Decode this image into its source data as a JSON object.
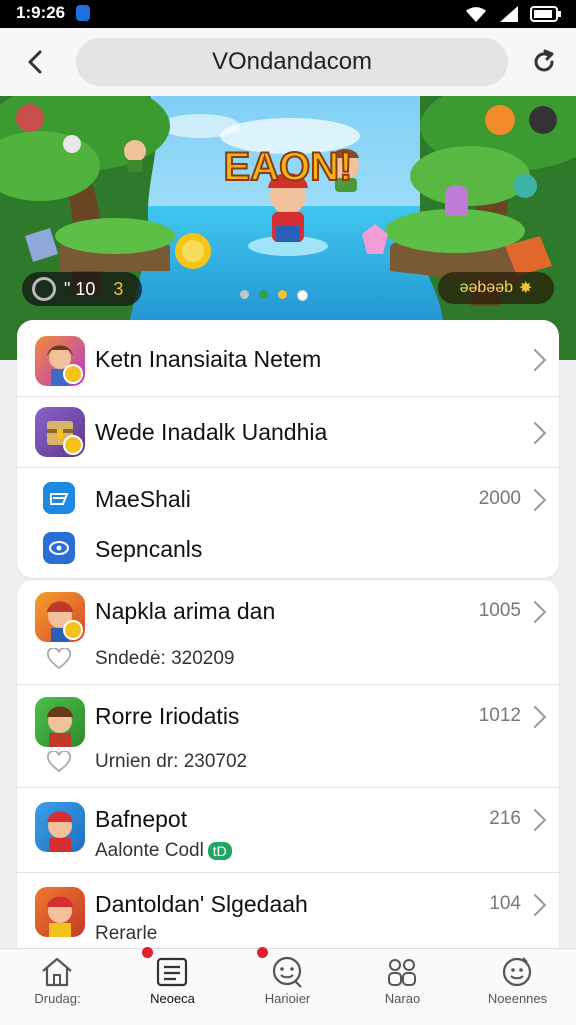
{
  "status_bar": {
    "time": "1:9:26"
  },
  "browser": {
    "url": "VOndandacom"
  },
  "banner": {
    "title": "EAON!",
    "left_pill_text": "\" 10",
    "left_pill_num": "3",
    "right_pill_text": "əəbəəb"
  },
  "menu": [
    {
      "label": "Ketn Inansiaita Netem"
    },
    {
      "label": "Wede Inadalk Uandhia"
    },
    {
      "label": "MaeShali",
      "count": "2000"
    },
    {
      "label": "Sepncanls"
    }
  ],
  "games": [
    {
      "title": "Napkla arima dan",
      "count": "1005",
      "sub": "Sndedė: 320209"
    },
    {
      "title": "Rorre Iriodatis",
      "count": "1012",
      "sub": "Urnien dr: 230702"
    },
    {
      "title": "Bafnepot",
      "count": "216",
      "sub": "Aalonte Codl",
      "badge": "tD"
    },
    {
      "title": "Dantoldan' Slgedaah",
      "count": "104",
      "sub": "Rerarle"
    }
  ],
  "tabs": [
    {
      "label": "Drudag:",
      "icon": "home-icon"
    },
    {
      "label": "Neoeca",
      "icon": "news-icon",
      "active": true
    },
    {
      "label": "Harioier",
      "icon": "chat-face-icon"
    },
    {
      "label": "Narao",
      "icon": "people-icon"
    },
    {
      "label": "Noeennes",
      "icon": "profile-icon"
    }
  ]
}
